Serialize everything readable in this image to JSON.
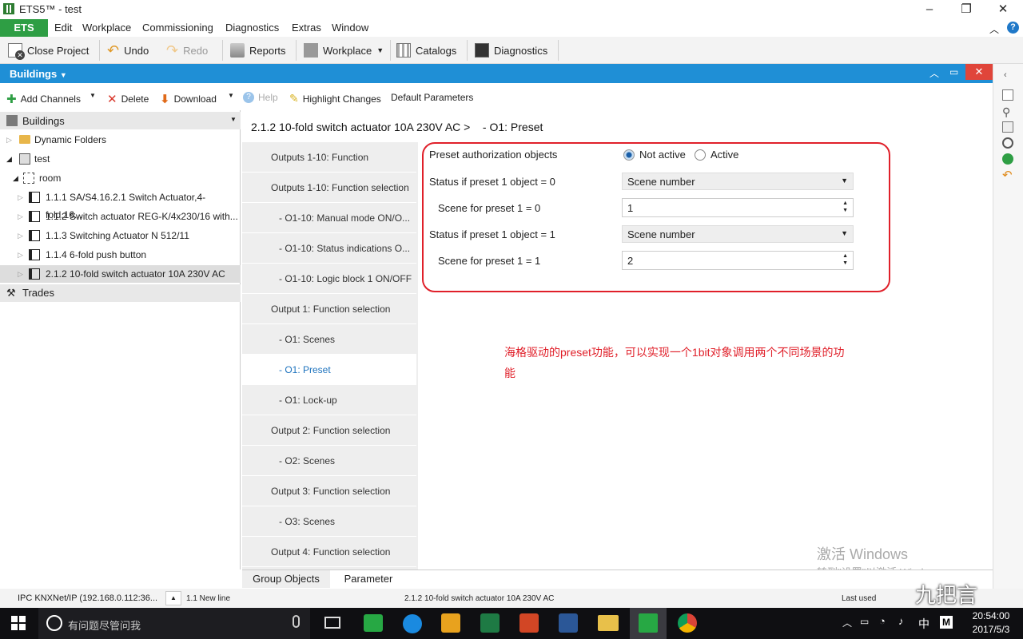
{
  "window": {
    "title": "ETS5™ - test"
  },
  "menu": {
    "app": "ETS",
    "items": [
      "Edit",
      "Workplace",
      "Commissioning",
      "Diagnostics",
      "Extras",
      "Window"
    ]
  },
  "toolbar": {
    "close": "Close Project",
    "undo": "Undo",
    "redo": "Redo",
    "reports": "Reports",
    "workplace": "Workplace",
    "catalogs": "Catalogs",
    "diagnostics": "Diagnostics"
  },
  "panel": {
    "title": "Buildings"
  },
  "subtoolbar": {
    "add": "Add Channels",
    "delete": "Delete",
    "download": "Download",
    "help": "Help",
    "highlight": "Highlight Changes",
    "defaults": "Default Parameters"
  },
  "tree": {
    "header": "Buildings",
    "items": [
      "Dynamic Folders",
      "test",
      "room",
      "1.1.1 SA/S4.16.2.1 Switch Actuator,4-fold,16...",
      "1.1.2 Switch actuator REG-K/4x230/16 with...",
      "1.1.3 Switching Actuator N 512/11",
      "1.1.4 6-fold push button",
      "2.1.2 10-fold switch actuator 10A 230V AC"
    ],
    "trades": "Trades"
  },
  "breadcrumb": "2.1.2 10-fold switch actuator 10A 230V AC >    - O1: Preset",
  "pages": [
    "Outputs 1-10: Function",
    "Outputs 1-10: Function selection",
    "- O1-10: Manual mode ON/O...",
    "- O1-10: Status indications O...",
    "- O1-10: Logic block 1 ON/OFF",
    "Output 1: Function selection",
    "- O1: Scenes",
    "- O1: Preset",
    "- O1: Lock-up",
    "Output 2: Function selection",
    "- O2: Scenes",
    "Output 3: Function selection",
    "- O3: Scenes",
    "Output 4: Function selection"
  ],
  "params": {
    "p1": "Preset authorization objects",
    "p1_opt1": "Not active",
    "p1_opt2": "Active",
    "p2": "Status if preset 1 object = 0",
    "p2_val": "Scene number",
    "p3": "Scene for preset 1 = 0",
    "p3_val": "1",
    "p4": "Status if preset 1 object = 1",
    "p4_val": "Scene number",
    "p5": "Scene for preset 1 = 1",
    "p5_val": "2"
  },
  "note": "海格驱动的preset功能，可以实现一个1bit对象调用两个不同场景的功能",
  "tabs": {
    "t1": "Group Objects",
    "t2": "Parameter"
  },
  "status": {
    "conn": "IPC KNXNet/IP (192.168.0.112:36...",
    "line": "1.1 New line",
    "device": "2.1.2 10-fold switch actuator 10A 230V AC",
    "last": "Last used"
  },
  "watermark": {
    "w1": "激活 Windows",
    "w2": "转到\"设置\"以激活 Windows。",
    "brand": "九把言"
  },
  "taskbar": {
    "search": "有问题尽管问我",
    "time": "20:54:00",
    "date": "2017/5/3",
    "ime": "中"
  }
}
